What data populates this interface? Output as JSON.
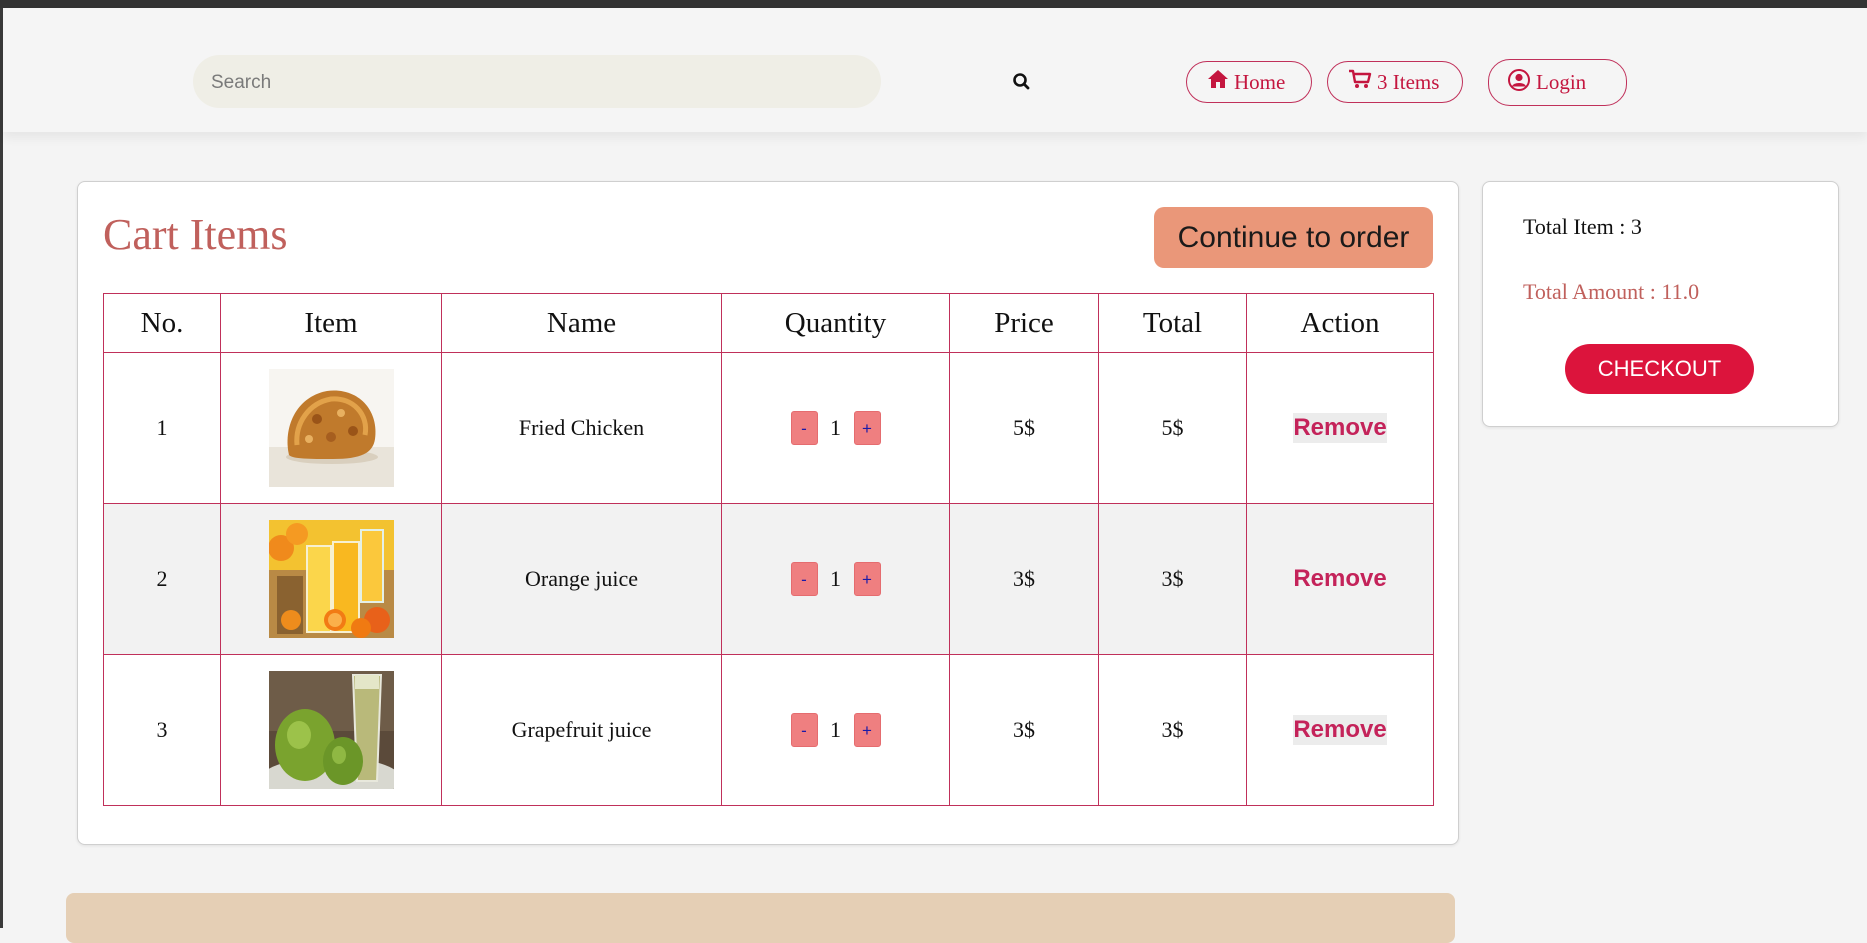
{
  "search": {
    "placeholder": "Search",
    "icon": "search-icon"
  },
  "nav": {
    "home": {
      "label": "Home",
      "icon": "home-icon"
    },
    "cart": {
      "label": "3 Items",
      "icon": "cart-icon"
    },
    "login": {
      "label": "Login",
      "icon": "user-circle-icon"
    }
  },
  "cart": {
    "title": "Cart Items",
    "continue_label": "Continue to order",
    "columns": [
      "No.",
      "Item",
      "Name",
      "Quantity",
      "Price",
      "Total",
      "Action"
    ],
    "rows": [
      {
        "no": "1",
        "image": "fried-chicken-image",
        "name": "Fried Chicken",
        "minus": "-",
        "qty": "1",
        "plus": "+",
        "price": "5$",
        "total": "5$",
        "action": "Remove"
      },
      {
        "no": "2",
        "image": "orange-juice-image",
        "name": "Orange juice",
        "minus": "-",
        "qty": "1",
        "plus": "+",
        "price": "3$",
        "total": "3$",
        "action": "Remove"
      },
      {
        "no": "3",
        "image": "grapefruit-juice-image",
        "name": "Grapefruit juice",
        "minus": "-",
        "qty": "1",
        "plus": "+",
        "price": "3$",
        "total": "3$",
        "action": "Remove"
      }
    ]
  },
  "summary": {
    "total_item": "Total Item : 3",
    "total_amount": "Total Amount : 11.0",
    "checkout_label": "CHECKOUT"
  },
  "colors": {
    "accent": "#dc143c",
    "title": "#c0605c",
    "continue": "#ea9779",
    "table_border": "#c0305a",
    "qty_button": "#ef7f80",
    "footer": "#e5cfb5"
  }
}
